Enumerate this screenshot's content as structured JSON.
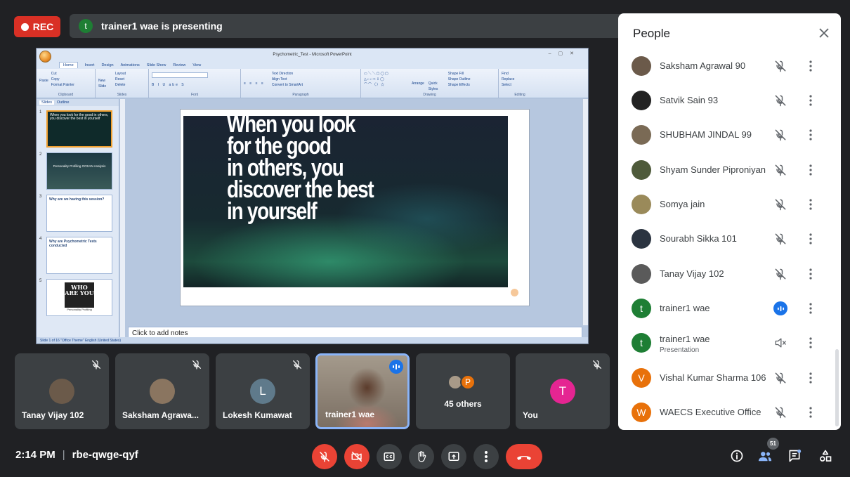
{
  "recording": {
    "label": "REC",
    "color": "#d93025"
  },
  "presenting_bar": {
    "avatar_initial": "t",
    "text": "trainer1 wae is presenting"
  },
  "shared_screen": {
    "window_title": "Psychometric_Test - Microsoft PowerPoint",
    "ribbon_tabs": [
      "Home",
      "Insert",
      "Design",
      "Animations",
      "Slide Show",
      "Review",
      "View"
    ],
    "ribbon_groups": {
      "clipboard": {
        "label": "Clipboard",
        "items": [
          "Cut",
          "Copy",
          "Format Painter"
        ],
        "paste": "Paste"
      },
      "slides": {
        "label": "Slides",
        "items": [
          "Layout",
          "Reset",
          "Delete"
        ],
        "new_slide": "New Slide"
      },
      "font": {
        "label": "Font"
      },
      "paragraph": {
        "label": "Paragraph",
        "items": [
          "Text Direction",
          "Align Text",
          "Convert to SmartArt"
        ]
      },
      "drawing": {
        "label": "Drawing",
        "items": [
          "Shape Fill",
          "Shape Outline",
          "Shape Effects"
        ],
        "arrange": "Arrange",
        "quick_styles": "Quick Styles"
      },
      "editing": {
        "label": "Editing",
        "items": [
          "Find",
          "Replace",
          "Select"
        ]
      }
    },
    "panel_tabs": [
      "Slides",
      "Outline"
    ],
    "thumbnails": [
      {
        "num": "1",
        "text": "When you look for the good in others, you discover the best in yourself"
      },
      {
        "num": "2",
        "text": "Personality Profiling OCEAN Analysis"
      },
      {
        "num": "3",
        "text": "Why are we having this session?"
      },
      {
        "num": "4",
        "text": "Why are Psychometric Tests conducted"
      },
      {
        "num": "5",
        "text": "WHO ARE YOU",
        "subtext": "Personality Profiling"
      }
    ],
    "slide_text": [
      "When you look",
      "for the good",
      "in others, you",
      "discover the best",
      "in yourself"
    ],
    "notes_placeholder": "Click to add notes",
    "status_bar": "Slide 1 of 16   \"Office Theme\"   English (United States)"
  },
  "tiles": [
    {
      "name": "Tanay Vijay 102",
      "muted": true,
      "avatar": "photo"
    },
    {
      "name": "Saksham Agrawa...",
      "muted": true,
      "avatar": "photo"
    },
    {
      "name": "Lokesh Kumawat",
      "muted": true,
      "initial": "L",
      "color": "#5f7a8b"
    },
    {
      "name": "trainer1 wae",
      "muted": false,
      "speaking": true
    },
    {
      "name": "45 others",
      "initial": "P",
      "color": "#e8710a"
    },
    {
      "name": "You",
      "muted": true,
      "initial": "T",
      "color": "#e52592"
    }
  ],
  "meeting": {
    "time": "2:14 PM",
    "separator": "|",
    "code": "rbe-qwge-qyf"
  },
  "controls": [
    "mic-off",
    "camera-off",
    "captions",
    "raise-hand",
    "present",
    "more",
    "end-call"
  ],
  "participant_count": "51",
  "people_panel": {
    "title": "People",
    "people": [
      {
        "name": "Saksham Agrawal 90",
        "avatar": "photo",
        "color": "#6b5a4a"
      },
      {
        "name": "Satvik Sain 93",
        "avatar": "photo",
        "color": "#222222"
      },
      {
        "name": "SHUBHAM JINDAL 99",
        "avatar": "photo",
        "color": "#7a6a55"
      },
      {
        "name": "Shyam Sunder Piproniyan",
        "avatar": "photo",
        "color": "#4e5a3a"
      },
      {
        "name": "Somya jain",
        "avatar": "photo",
        "color": "#9a8a5a"
      },
      {
        "name": "Sourabh Sikka 101",
        "avatar": "photo",
        "color": "#2b3440"
      },
      {
        "name": "Tanay Vijay 102",
        "avatar": "photo",
        "color": "#5a5a5a"
      },
      {
        "name": "trainer1 wae",
        "initial": "t",
        "color": "#1e7e34",
        "speaking": true
      },
      {
        "name": "trainer1 wae",
        "sub": "Presentation",
        "initial": "t",
        "color": "#1e7e34",
        "presentation": true
      },
      {
        "name": "Vishal Kumar Sharma 106",
        "initial": "V",
        "color": "#e8710a"
      },
      {
        "name": "WAECS Executive Office",
        "initial": "W",
        "color": "#e8710a"
      }
    ]
  }
}
